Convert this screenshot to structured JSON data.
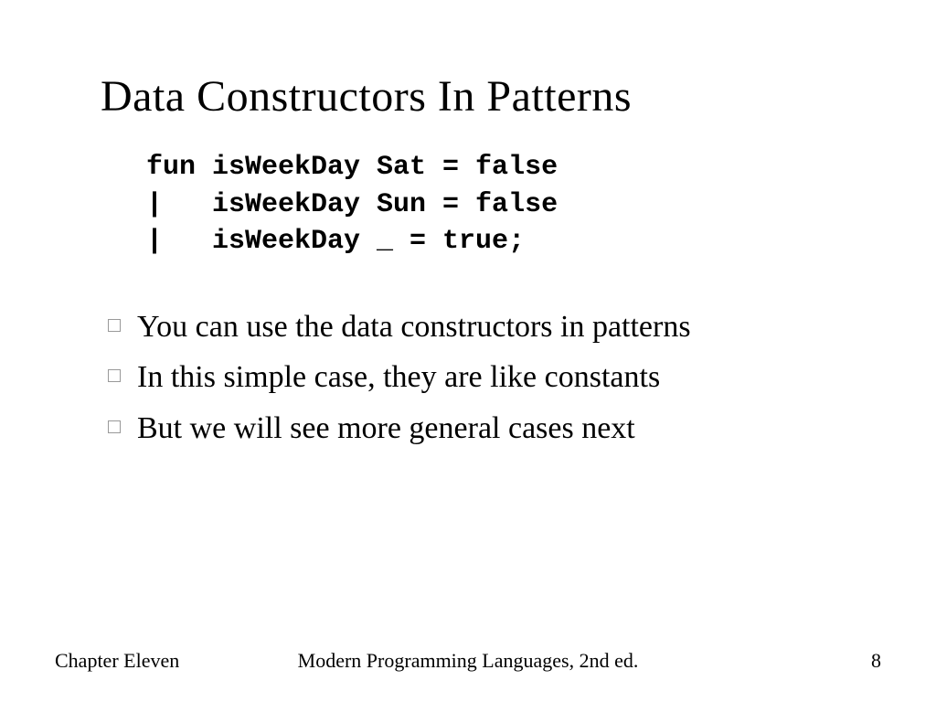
{
  "slide": {
    "title": "Data Constructors In Patterns",
    "code": "fun isWeekDay Sat = false\n|   isWeekDay Sun = false\n|   isWeekDay _ = true;",
    "bullets": [
      "You can use the data constructors in patterns",
      "In this simple case, they are like constants",
      "But we will see more general cases next"
    ],
    "footer": {
      "left": "Chapter Eleven",
      "center": "Modern Programming Languages, 2nd ed.",
      "right": "8"
    }
  }
}
